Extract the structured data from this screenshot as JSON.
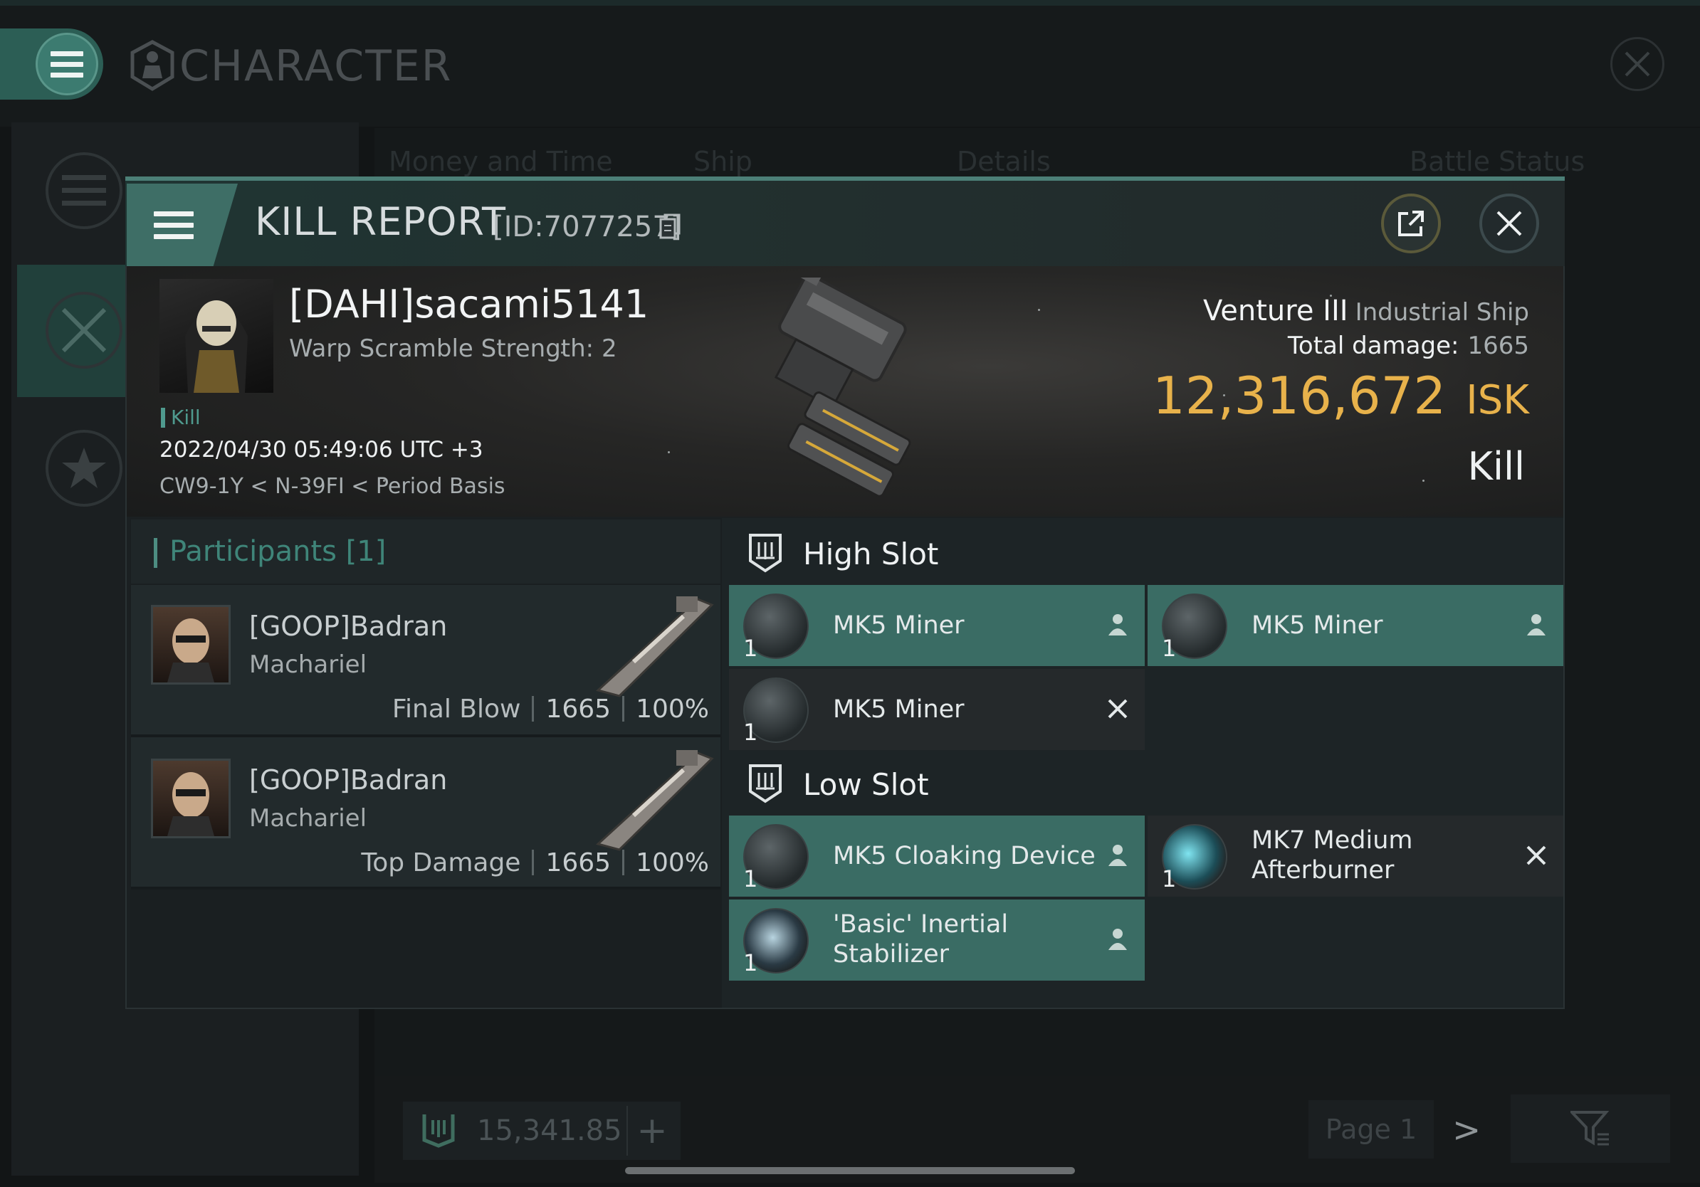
{
  "window": {
    "title": "CHARACTER",
    "bg_tabs": [
      "Money and Time",
      "Ship",
      "Details",
      "Battle Status"
    ],
    "wallet_amount": "15,341.85",
    "wallet_add": "+",
    "page_label": "Page 1",
    "page_next": ">"
  },
  "kill_report": {
    "title": "KILL REPORT",
    "id_label": "[ID:7077257]",
    "victim": {
      "name": "[DAHI]sacami5141",
      "warp_scramble": "Warp Scramble Strength: 2",
      "tag": "Kill",
      "datetime": "2022/04/30 05:49:06 UTC +3",
      "location": "CW9-1Y < N-39FI < Period Basis"
    },
    "ship": {
      "name": "Venture III",
      "class": "Industrial Ship",
      "total_damage_label": "Total damage:",
      "total_damage": "1665",
      "isk_value": "12,316,672",
      "isk_unit": "ISK",
      "result": "Kill"
    },
    "participants": {
      "title": "Participants [1]",
      "list": [
        {
          "name": "[GOOP]Badran",
          "ship": "Machariel",
          "role": "Final Blow",
          "damage": "1665",
          "percent": "100%"
        },
        {
          "name": "[GOOP]Badran",
          "ship": "Machariel",
          "role": "Top Damage",
          "damage": "1665",
          "percent": "100%"
        }
      ]
    },
    "fitting": {
      "high_slot": {
        "title": "High Slot",
        "modules": [
          {
            "qty": "1",
            "name": "MK5 Miner",
            "state": "fitted"
          },
          {
            "qty": "1",
            "name": "MK5 Miner",
            "state": "fitted"
          },
          {
            "qty": "1",
            "name": "MK5 Miner",
            "state": "destroyed"
          }
        ]
      },
      "low_slot": {
        "title": "Low Slot",
        "modules": [
          {
            "qty": "1",
            "name": "MK5 Cloaking Device",
            "state": "fitted"
          },
          {
            "qty": "1",
            "name_line1": "MK7 Medium",
            "name_line2": "Afterburner",
            "state": "destroyed"
          },
          {
            "qty": "1",
            "name_line1": "'Basic' Inertial",
            "name_line2": "Stabilizer",
            "state": "fitted"
          }
        ]
      }
    }
  },
  "colors": {
    "accent": "#3a6c64",
    "isk_gold": "#e8b24b",
    "participants_title": "#3f8579"
  },
  "icons": [
    "hamburger-menu-icon",
    "character-icon",
    "close-icon",
    "share-icon",
    "copy-icon",
    "kill-tag-icon",
    "slot-icon",
    "user-icon",
    "x-icon",
    "wallet-icon",
    "filter-icon"
  ]
}
